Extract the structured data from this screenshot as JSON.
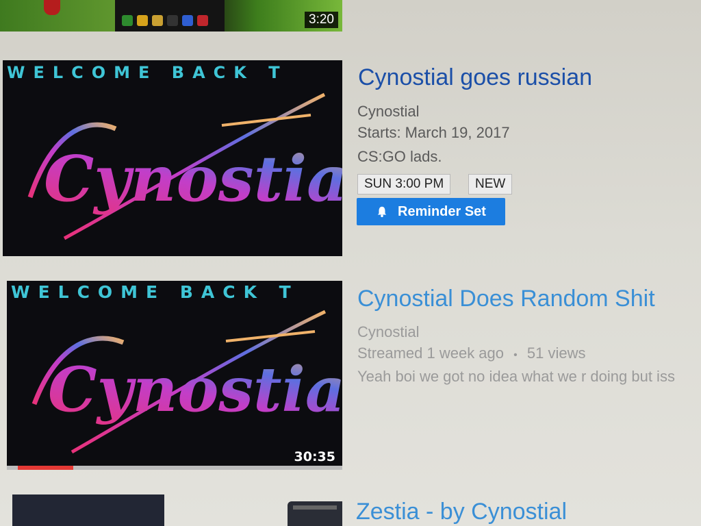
{
  "videos": [
    {
      "duration": "3:20"
    },
    {
      "thumbnail_banner": "WELCOME BACK T",
      "thumbnail_logo": "Cynostial",
      "title": "Cynostial goes russian",
      "channel": "Cynostial",
      "starts": "Starts: March 19, 2017",
      "description": "CS:GO lads.",
      "badges": [
        "SUN 3:00 PM",
        "NEW"
      ],
      "reminder_label": "Reminder Set"
    },
    {
      "thumbnail_banner": "WELCOME BACK T",
      "thumbnail_logo": "Cynostial",
      "duration": "30:35",
      "watch_progress_percent": 17,
      "title": "Cynostial Does Random Shit",
      "channel": "Cynostial",
      "streamed": "Streamed 1 week ago",
      "separator": "•",
      "views": "51 views",
      "description": "Yeah boi we got no idea what we r doing but iss"
    },
    {
      "title": "Zestia - by Cynostial"
    }
  ],
  "colors": {
    "title_blue": "#1b4fa8",
    "button_blue": "#1c7de0",
    "progress_red": "#e53935"
  }
}
